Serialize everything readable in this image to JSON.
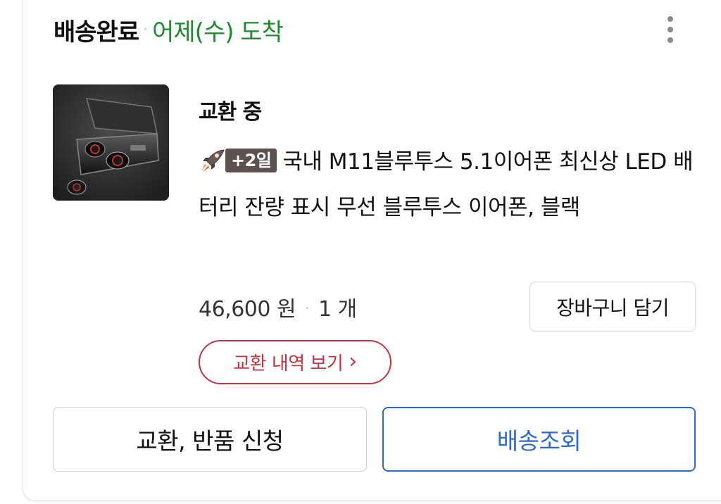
{
  "order": {
    "status": "배송완료",
    "separator": "·",
    "arrival": "어제(수) 도착"
  },
  "item": {
    "state": "교환 중",
    "badge": "+2일",
    "title": "국내 M11블루투스 5.1이어폰 최신상 LED 배터리 잔량 표시 무선 블루투스 이어폰, 블랙",
    "price": "46,600 원",
    "quantity": "1 개",
    "dot": "·"
  },
  "buttons": {
    "cart": "장바구니 담기",
    "history": "교환 내역 보기",
    "history_chevron": "›",
    "return": "교환, 반품 신청",
    "track": "배송조회"
  },
  "icons": {
    "more": "more-vertical-icon",
    "rocket": "rocket-icon"
  },
  "colors": {
    "arrival": "#1c8a2e",
    "history": "#c0353f",
    "track": "#2d6bd1",
    "badge": "#5a5150"
  }
}
